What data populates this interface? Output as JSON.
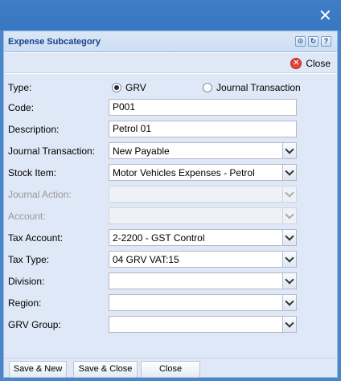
{
  "window": {
    "close_glyph": "✕"
  },
  "panel": {
    "title": "Expense Subcategory",
    "tools": [
      {
        "icon": "gear-icon",
        "glyph": "⚙"
      },
      {
        "icon": "refresh-icon",
        "glyph": "↻"
      },
      {
        "icon": "help-icon",
        "glyph": "?"
      }
    ]
  },
  "toolbar": {
    "close_label": "Close",
    "close_glyph": "✕"
  },
  "form": {
    "type_label": "Type:",
    "type_options": [
      "GRV",
      "Journal Transaction"
    ],
    "type_selected": "GRV",
    "code_label": "Code:",
    "code_value": "P001",
    "description_label": "Description:",
    "description_value": "Petrol 01",
    "journal_transaction_label": "Journal Transaction:",
    "journal_transaction_value": "New Payable",
    "stock_item_label": "Stock Item:",
    "stock_item_value": "Motor Vehicles Expenses - Petrol",
    "journal_action_label": "Journal Action:",
    "journal_action_value": "",
    "account_label": "Account:",
    "account_value": "",
    "tax_account_label": "Tax Account:",
    "tax_account_value": "2-2200 - GST Control",
    "tax_type_label": "Tax Type:",
    "tax_type_value": "04 GRV VAT:15",
    "division_label": "Division:",
    "division_value": "",
    "region_label": "Region:",
    "region_value": "",
    "grv_group_label": "GRV Group:",
    "grv_group_value": ""
  },
  "footer": {
    "save_new_label": "Save & New",
    "save_close_label": "Save & Close",
    "close_label": "Close"
  }
}
